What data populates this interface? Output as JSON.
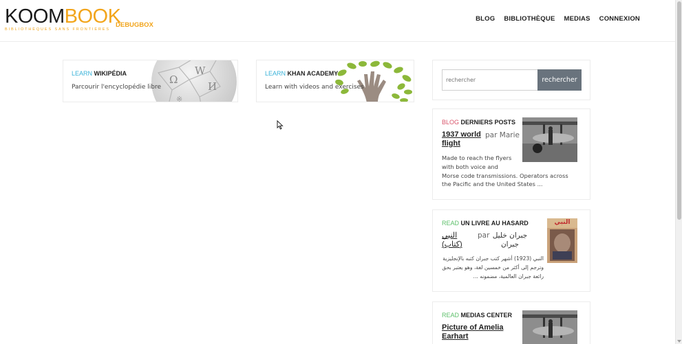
{
  "logo": {
    "koom": "KOOM",
    "book": "BOOK",
    "tagline": "BIBLIOTHÈQUES SANS FRONTIÈRES",
    "badge": "DEBUGBOX"
  },
  "nav": [
    "BLOG",
    "BIBLIOTHÈQUE",
    "MEDIAS",
    "CONNEXION"
  ],
  "learn_cards": [
    {
      "kicker": "LEARN",
      "title": "WIKIPÉDIA",
      "description": "Parcourir l'encyclopédie libre",
      "icon": "wikipedia-globe-icon"
    },
    {
      "kicker": "LEARN",
      "title": "KHAN ACADEMY",
      "description": "Learn with videos and exercises",
      "icon": "khan-tree-icon"
    }
  ],
  "search": {
    "placeholder": "rechercher",
    "button": "rechercher"
  },
  "blog": {
    "kicker": "BLOG",
    "title": "DERNIERS POSTS",
    "post_line1": "1937 world",
    "post_line2": "flight",
    "author": "par Marie",
    "excerpt": [
      "Made to reach the flyers",
      "with both voice and",
      "Morse code transmissions. Operators across",
      "the Pacific and the United States ..."
    ]
  },
  "random_book": {
    "kicker": "READ",
    "title": "UN LIVRE AU HASARD",
    "book_line1": "النبي",
    "book_line2": "(كتاب)",
    "by": "par",
    "author_line1": "جبران خليل",
    "author_line2": "جبران",
    "excerpt": [
      "النبي (1923) أشهر كتب جبران كتبه بالإنجليزية",
      "وترجم إلى أكثر من خمسين لغة، وهو يعتبر بحق",
      "رائعة جبران العالمية، مضمونه ..."
    ],
    "cover_title": "النبي"
  },
  "media": {
    "kicker": "READ",
    "title": "MEDIAS CENTER",
    "item_line1": "Picture of Amelia",
    "item_line2": "Earhart"
  },
  "colors": {
    "accent": "#f2a51c",
    "learn": "#3ab3d9",
    "blog": "#d9546a",
    "read": "#5cbf6a",
    "search_button": "#69737d"
  }
}
